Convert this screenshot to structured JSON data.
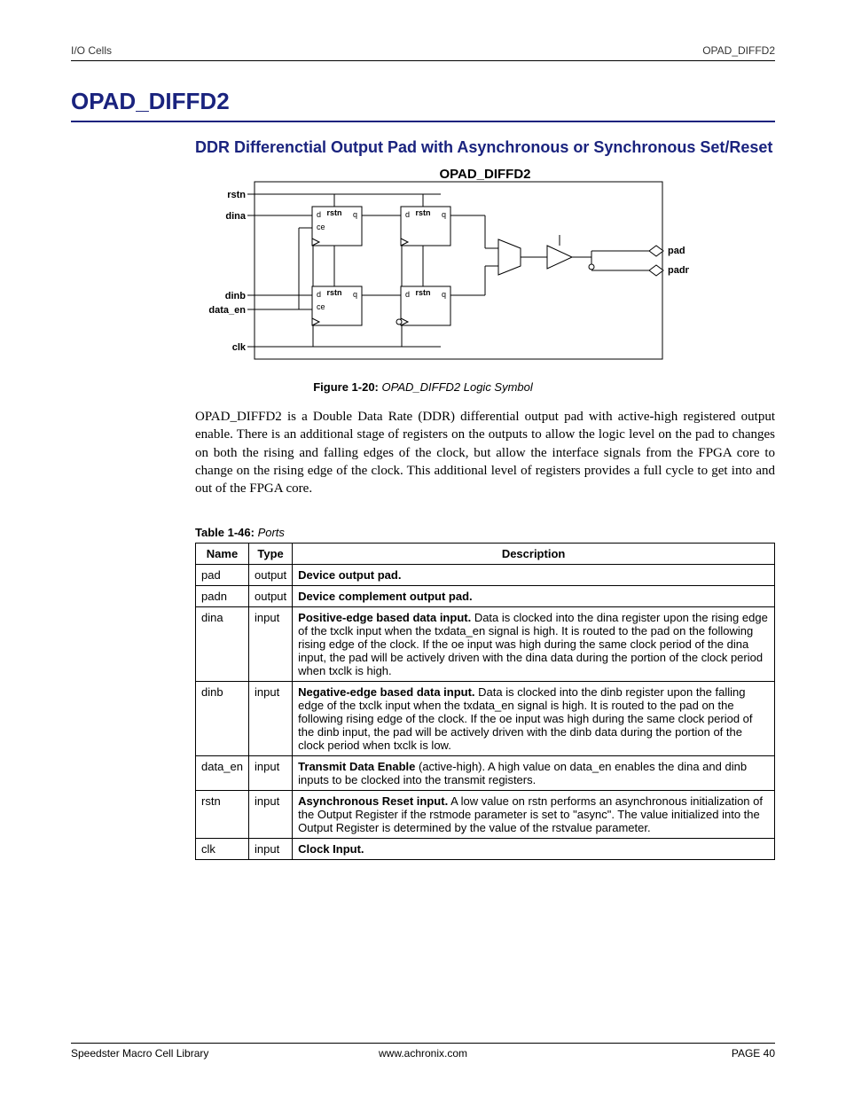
{
  "header": {
    "left": "I/O Cells",
    "right": "OPAD_DIFFD2"
  },
  "title": "OPAD_DIFFD2",
  "subtitle": "DDR Differenctial Output Pad with Asynchronous or Synchronous Set/Reset",
  "diagram": {
    "title": "OPAD_DIFFD2",
    "labels": {
      "rstn": "rstn",
      "dina": "dina",
      "dinb": "dinb",
      "data_en": "data_en",
      "clk": "clk",
      "pad": "pad",
      "padn": "padn",
      "d": "d",
      "ce": "ce",
      "q": "q",
      "rstn_small": "rstn"
    }
  },
  "figcap": {
    "prefix": "Figure 1-20:",
    "text": "OPAD_DIFFD2 Logic Symbol"
  },
  "body": "OPAD_DIFFD2 is a Double Data Rate (DDR) differential output pad with active-high registered output enable. There is an additional stage of registers on the outputs to allow the logic level on the pad to changes on both the rising and falling edges of the clock, but allow the interface signals from the FPGA core to change on the rising edge of the clock.  This additional level of registers provides a full cycle to get into and out of the FPGA core.",
  "tablecap": {
    "prefix": "Table 1-46:",
    "text": "Ports"
  },
  "table": {
    "headers": {
      "name": "Name",
      "type": "Type",
      "desc": "Description"
    },
    "rows": [
      {
        "name": "pad",
        "type": "output",
        "lead": "Device output pad.",
        "rest": ""
      },
      {
        "name": "padn",
        "type": "output",
        "lead": "Device complement output pad.",
        "rest": ""
      },
      {
        "name": "dina",
        "type": "input",
        "lead": "Positive-edge based data input.",
        "rest": " Data is clocked into the dina register upon the rising edge of the txclk input when the txdata_en signal is high. It is routed to the pad on the following rising edge of the clock. If the oe input was high during the same clock period of the dina input, the pad will be actively driven with the dina data during the portion of the clock period when txclk is high."
      },
      {
        "name": "dinb",
        "type": "input",
        "lead": "Negative-edge based data input.",
        "rest": " Data is clocked into the dinb register upon the falling edge of the txclk input when the txdata_en signal is high. It is routed to the pad on the following rising edge of the clock. If the oe input was high during the same clock period of the dinb input, the pad will be actively driven with the dinb data during the portion of the clock period when txclk is low."
      },
      {
        "name": "data_en",
        "type": "input",
        "lead": "Transmit Data Enable",
        "rest": " (active-high). A high value on data_en enables the dina and dinb inputs to be clocked into the transmit registers."
      },
      {
        "name": "rstn",
        "type": "input",
        "lead": "Asynchronous Reset input.",
        "rest": " A low value on rstn performs an asynchronous initialization of the Output Register if the rstmode parameter is set to \"async\". The value initialized into the Output Register is determined by the value of the rstvalue parameter."
      },
      {
        "name": "clk",
        "type": "input",
        "lead": "Clock Input.",
        "rest": ""
      }
    ]
  },
  "footer": {
    "left": "Speedster Macro Cell Library",
    "center": "www.achronix.com",
    "right": "PAGE 40"
  }
}
